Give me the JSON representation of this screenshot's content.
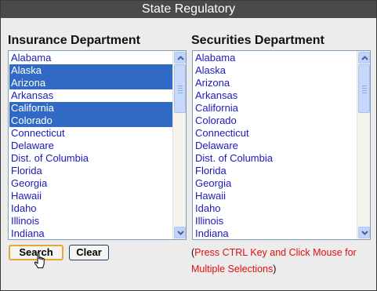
{
  "title": "State Regulatory",
  "insurance": {
    "heading": "Insurance Department",
    "states": [
      {
        "name": "Alabama",
        "selected": false
      },
      {
        "name": "Alaska",
        "selected": true
      },
      {
        "name": "Arizona",
        "selected": true
      },
      {
        "name": "Arkansas",
        "selected": false
      },
      {
        "name": "California",
        "selected": true
      },
      {
        "name": "Colorado",
        "selected": true
      },
      {
        "name": "Connecticut",
        "selected": false
      },
      {
        "name": "Delaware",
        "selected": false
      },
      {
        "name": "Dist. of Columbia",
        "selected": false
      },
      {
        "name": "Florida",
        "selected": false
      },
      {
        "name": "Georgia",
        "selected": false
      },
      {
        "name": "Hawaii",
        "selected": false
      },
      {
        "name": "Idaho",
        "selected": false
      },
      {
        "name": "Illinois",
        "selected": false
      },
      {
        "name": "Indiana",
        "selected": false
      }
    ]
  },
  "securities": {
    "heading": "Securities Department",
    "states": [
      {
        "name": "Alabama",
        "selected": false
      },
      {
        "name": "Alaska",
        "selected": false
      },
      {
        "name": "Arizona",
        "selected": false
      },
      {
        "name": "Arkansas",
        "selected": false
      },
      {
        "name": "California",
        "selected": false
      },
      {
        "name": "Colorado",
        "selected": false
      },
      {
        "name": "Connecticut",
        "selected": false
      },
      {
        "name": "Delaware",
        "selected": false
      },
      {
        "name": "Dist. of Columbia",
        "selected": false
      },
      {
        "name": "Florida",
        "selected": false
      },
      {
        "name": "Georgia",
        "selected": false
      },
      {
        "name": "Hawaii",
        "selected": false
      },
      {
        "name": "Idaho",
        "selected": false
      },
      {
        "name": "Illinois",
        "selected": false
      },
      {
        "name": "Indiana",
        "selected": false
      }
    ]
  },
  "buttons": {
    "search": "Search",
    "clear": "Clear"
  },
  "hint": {
    "open": "(",
    "text": "Press CTRL Key and Click Mouse for Multiple Selections",
    "close": ")"
  },
  "icons": {
    "scroll_up": "chevron-up-icon",
    "scroll_down": "chevron-down-icon",
    "cursor": "hand-pointer-icon"
  },
  "colors": {
    "title_bar": "#4a4a4a",
    "selection": "#316ac5",
    "list_text": "#1a1ab8",
    "hint_text": "#e01010",
    "search_focus": "#e8a53a"
  }
}
